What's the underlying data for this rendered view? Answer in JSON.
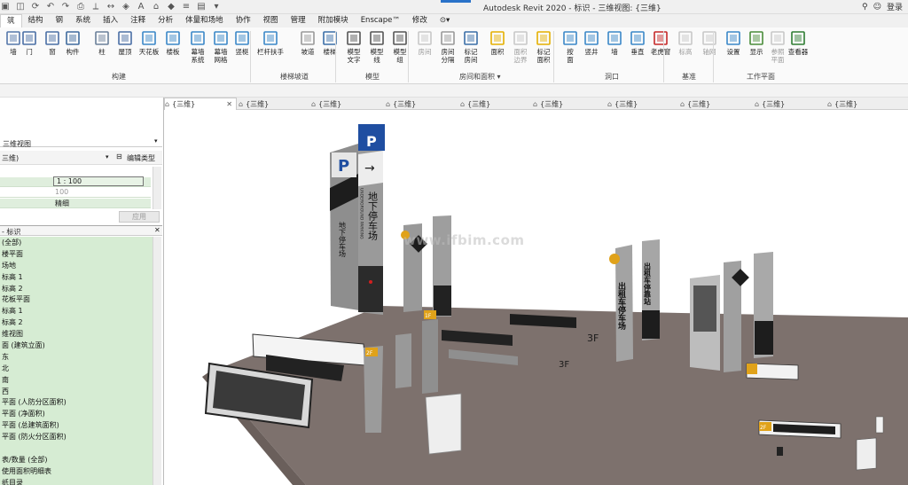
{
  "title_bar": {
    "app_title": "Autodesk Revit 2020 - 标识 - 三维视图: {三维}",
    "login_label": "登录",
    "qat_icons": [
      "open-icon",
      "save-icon",
      "sync-icon",
      "undo-icon",
      "redo-icon",
      "print-icon",
      "measure-icon",
      "dimension-icon",
      "tag-icon",
      "text-icon",
      "3d-view-icon",
      "section-icon",
      "thin-lines-icon",
      "switch-windows-icon",
      "dropdown-icon"
    ]
  },
  "menu_tabs": [
    {
      "label": "筑",
      "active": true
    },
    {
      "label": "结构"
    },
    {
      "label": "钢"
    },
    {
      "label": "系统"
    },
    {
      "label": "插入"
    },
    {
      "label": "注释"
    },
    {
      "label": "分析"
    },
    {
      "label": "体量和场地"
    },
    {
      "label": "协作"
    },
    {
      "label": "视图"
    },
    {
      "label": "管理"
    },
    {
      "label": "附加模块"
    },
    {
      "label": "Enscape™"
    },
    {
      "label": "修改"
    }
  ],
  "ribbon": {
    "buttons": [
      {
        "id": "wall",
        "label": "墙",
        "icon": "wall-icon"
      },
      {
        "id": "door",
        "label": "门",
        "icon": "door-icon"
      },
      {
        "id": "window",
        "label": "窗",
        "icon": "window-icon"
      },
      {
        "id": "component",
        "label": "构件",
        "icon": "component-icon"
      },
      {
        "id": "column",
        "label": "柱",
        "icon": "column-icon"
      },
      {
        "id": "roof",
        "label": "屋顶",
        "icon": "roof-icon"
      },
      {
        "id": "ceiling",
        "label": "天花板",
        "icon": "ceiling-icon"
      },
      {
        "id": "floor",
        "label": "楼板",
        "icon": "floor-icon"
      },
      {
        "id": "curtain-system",
        "label": "幕墙\n系统",
        "icon": "curtain-system-icon"
      },
      {
        "id": "curtain-grid",
        "label": "幕墙\n网格",
        "icon": "curtain-grid-icon"
      },
      {
        "id": "mullion",
        "label": "竖梃",
        "icon": "mullion-icon"
      },
      {
        "id": "railing",
        "label": "栏杆扶手",
        "icon": "railing-icon"
      },
      {
        "id": "ramp",
        "label": "坡道",
        "icon": "ramp-icon"
      },
      {
        "id": "stair",
        "label": "楼梯",
        "icon": "stair-icon"
      },
      {
        "id": "model-text",
        "label": "模型\n文字",
        "icon": "model-text-icon"
      },
      {
        "id": "model-line",
        "label": "模型\n线",
        "icon": "model-line-icon"
      },
      {
        "id": "model-group",
        "label": "模型\n组",
        "icon": "model-group-icon"
      },
      {
        "id": "room",
        "label": "房间",
        "icon": "room-icon",
        "disabled": true
      },
      {
        "id": "room-separator",
        "label": "房间\n分隔",
        "icon": "room-separator-icon"
      },
      {
        "id": "tag-room",
        "label": "标记\n房间",
        "icon": "tag-room-icon"
      },
      {
        "id": "area",
        "label": "面积",
        "icon": "area-icon"
      },
      {
        "id": "area-boundary",
        "label": "面积\n边界",
        "icon": "area-boundary-icon",
        "disabled": true
      },
      {
        "id": "tag-area",
        "label": "标记\n面积",
        "icon": "tag-area-icon"
      },
      {
        "id": "by-face",
        "label": "按\n面",
        "icon": "by-face-icon"
      },
      {
        "id": "shaft",
        "label": "竖井",
        "icon": "shaft-icon"
      },
      {
        "id": "opening-wall",
        "label": "墙",
        "icon": "wall-opening-icon"
      },
      {
        "id": "vertical",
        "label": "垂直",
        "icon": "vertical-opening-icon"
      },
      {
        "id": "dormer",
        "label": "老虎窗",
        "icon": "dormer-icon"
      },
      {
        "id": "level",
        "label": "标高",
        "icon": "level-icon",
        "disabled": true
      },
      {
        "id": "grid",
        "label": "轴网",
        "icon": "grid-icon",
        "disabled": true
      },
      {
        "id": "set",
        "label": "设置",
        "icon": "set-workplane-icon"
      },
      {
        "id": "show",
        "label": "显示",
        "icon": "show-workplane-icon"
      },
      {
        "id": "ref-plane",
        "label": "参照\n平面",
        "icon": "ref-plane-icon",
        "disabled": true
      },
      {
        "id": "viewer",
        "label": "查看器",
        "icon": "viewer-icon"
      }
    ],
    "panels": [
      {
        "label": "构建"
      },
      {
        "label": "楼梯坡道"
      },
      {
        "label": "模型"
      },
      {
        "label": "房间和面积 ▾"
      },
      {
        "label": "洞口"
      },
      {
        "label": "基准"
      },
      {
        "label": "工作平面"
      }
    ]
  },
  "view_tabs": [
    {
      "label": "{三维}",
      "active": true
    },
    {
      "label": "{三维}"
    },
    {
      "label": "{三维}"
    },
    {
      "label": "{三维}"
    },
    {
      "label": "{三维}"
    },
    {
      "label": "{三维}"
    },
    {
      "label": "{三维}"
    },
    {
      "label": "{三维}"
    },
    {
      "label": "{三维}"
    },
    {
      "label": "{三维}"
    }
  ],
  "properties": {
    "type_name": "三维视图",
    "instance_selector": "三维)",
    "edit_type_label": "编辑类型",
    "scale_value": "1 : 100",
    "scale_num": "100",
    "detail_level": "精细",
    "apply_label": "应用"
  },
  "browser": {
    "title": "- 标识",
    "items": [
      "(全部)",
      "楼平面",
      "场地",
      "标高 1",
      "标高 2",
      "花板平面",
      "标高 1",
      "标高 2",
      "维视图",
      "面 (建筑立面)",
      "东",
      "北",
      "南",
      "西",
      "平面 (人防分区面积)",
      "平面 (净面积)",
      "平面 (总建筑面积)",
      "平面 (防火分区面积)",
      "",
      "表/数量 (全部)",
      "使用面积明细表",
      "纸目录"
    ]
  },
  "scene": {
    "watermark": "www.ifbim.com",
    "sign_texts": {
      "p_letter": "P",
      "underground_parking": "地下停车场",
      "underground_parking_en": "UNDERGROUND PARKING",
      "exit_parking": "出租车停车场",
      "exit_parking_2": "出租车停靠站",
      "floor_3f": "3F",
      "floor_2f": "2F",
      "floor_1f": "1F"
    },
    "colors": {
      "floor": "#7d716d",
      "sign_grey": "#8b8b8b",
      "sign_dark": "#1d1d1d",
      "parking_blue": "#1f4ea1",
      "accent_orange": "#e0a21a",
      "red_led": "#d21f1f"
    }
  }
}
